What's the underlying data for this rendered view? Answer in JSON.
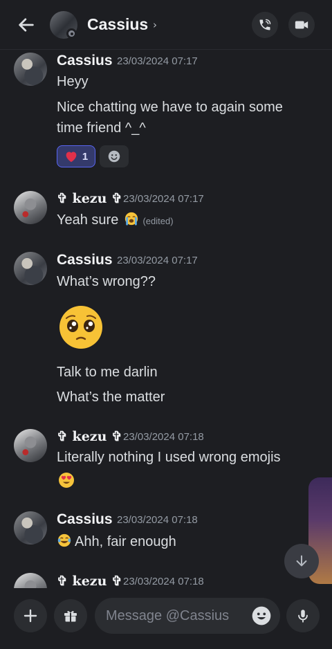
{
  "header": {
    "name": "Cassius",
    "chevron": "›",
    "icons": [
      "back-arrow-icon",
      "phone-icon",
      "video-camera-icon"
    ]
  },
  "messages": [
    {
      "author": "Cassius",
      "timestamp": "23/03/2024 07:17",
      "lines": [
        "Heyy",
        "Nice chatting we have to again some",
        "time friend ^_^"
      ]
    },
    {
      "author": "✞ kezu ✞",
      "timestamp": "23/03/2024 07:17",
      "text": "Yeah sure",
      "edited": "(edited)"
    },
    {
      "author": "Cassius",
      "timestamp": "23/03/2024 07:17",
      "lines": [
        "What’s wrong??",
        "Talk to me darlin",
        "What’s the matter"
      ]
    },
    {
      "author": "✞ kezu ✞",
      "timestamp": "23/03/2024 07:18",
      "text": "Literally nothing I used wrong emojis"
    },
    {
      "author": "Cassius",
      "timestamp": "23/03/2024 07:18",
      "text": "Ahh, fair enough"
    },
    {
      "author": "✞ kezu ✞",
      "timestamp": "23/03/2024 07:18"
    }
  ],
  "reaction": {
    "emoji": "heart-icon",
    "count": "1"
  },
  "composer": {
    "placeholder": "Message @Cassius"
  },
  "colors": {
    "background": "#1d1e22",
    "reaction_bg": "#343a6b",
    "reaction_border": "#5865f2",
    "timestamp": "#949ba4"
  }
}
